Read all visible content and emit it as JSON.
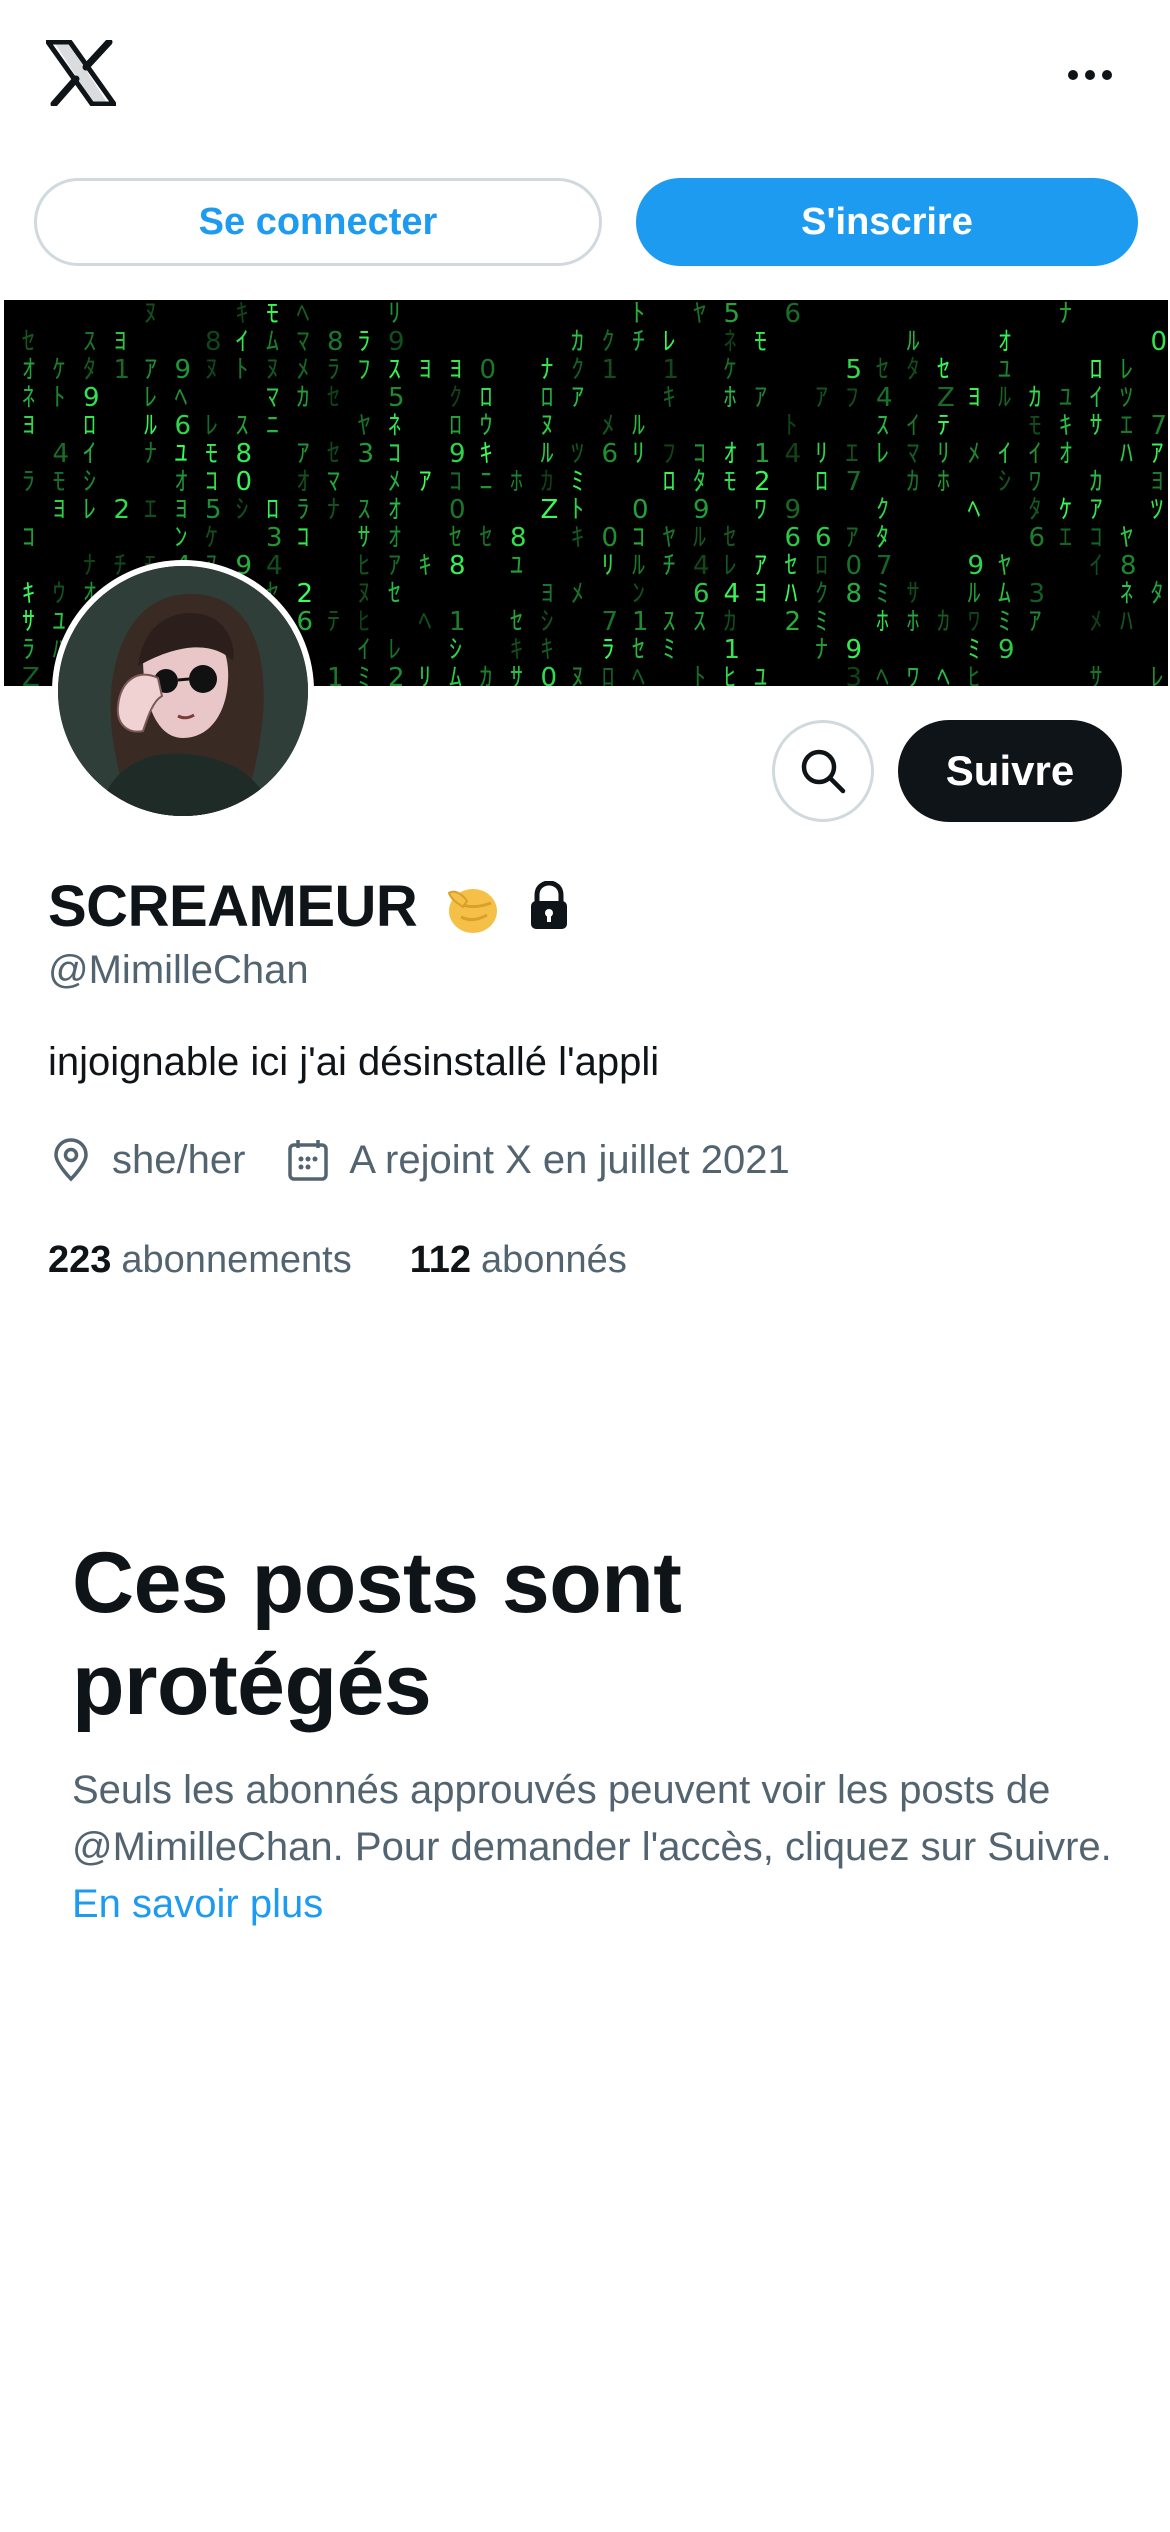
{
  "header": {
    "logo_icon": "x-logo-icon",
    "more_icon": "more-horizontal-icon"
  },
  "auth": {
    "login_label": "Se connecter",
    "signup_label": "S'inscrire"
  },
  "profile": {
    "display_name": "SCREAMEUR",
    "name_emoji": "pointing-hand-emoji",
    "protected_icon": "lock-icon",
    "handle": "@MimilleChan",
    "bio": "injoignable ici j'ai désinstallé l'appli",
    "location": "she/her",
    "joined": "A rejoint X en juillet 2021",
    "following_count": "223",
    "following_label": "abonnements",
    "followers_count": "112",
    "followers_label": "abonnés"
  },
  "actions": {
    "search_icon": "search-icon",
    "follow_label": "Suivre"
  },
  "protected": {
    "title_line1": "Ces posts sont",
    "title_line2": "protégés",
    "description": "Seuls les abonnés approuvés peuvent voir les posts de @MimilleChan. Pour demander l'accès, cliquez sur Suivre.",
    "link_label": "En savoir plus"
  },
  "colors": {
    "accent": "#1d9bf0",
    "text_primary": "#0f1419",
    "text_secondary": "#536471",
    "border": "#cfd9de",
    "banner_green": "#39ff5a"
  }
}
